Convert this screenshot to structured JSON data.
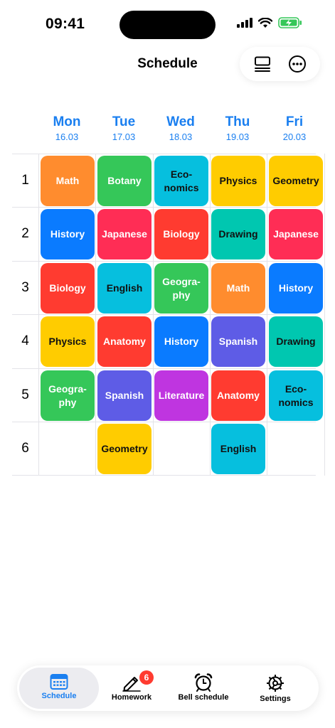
{
  "status_bar": {
    "time": "09:41"
  },
  "header": {
    "title": "Schedule",
    "layout_icon": "list-layout-icon",
    "more_icon": "ellipsis-circle-icon"
  },
  "days": [
    {
      "name": "Mon",
      "date": "16.03"
    },
    {
      "name": "Tue",
      "date": "17.03"
    },
    {
      "name": "Wed",
      "date": "18.03"
    },
    {
      "name": "Thu",
      "date": "19.03"
    },
    {
      "name": "Fri",
      "date": "20.03"
    }
  ],
  "periods": [
    "1",
    "2",
    "3",
    "4",
    "5",
    "6"
  ],
  "colors": {
    "orange": "#FF8C2E",
    "green": "#35C759",
    "cyan": "#06BFDE",
    "yellow": "#FFCC00",
    "blue": "#0A7BFF",
    "pink": "#FF2D55",
    "red": "#FF3B30",
    "teal": "#00C7B0",
    "indigo": "#5E5CE6",
    "purple": "#BF35E0",
    "accent": "#1A7FF0"
  },
  "lessons": [
    [
      {
        "name": "Math",
        "color": "orange",
        "text": "light"
      },
      {
        "name": "Botany",
        "color": "green",
        "text": "light"
      },
      {
        "name": "Eco-\nnomics",
        "color": "cyan",
        "text": "dark"
      },
      {
        "name": "Physics",
        "color": "yellow",
        "text": "dark"
      },
      {
        "name": "Geometry",
        "color": "yellow",
        "text": "dark"
      }
    ],
    [
      {
        "name": "History",
        "color": "blue",
        "text": "light"
      },
      {
        "name": "Japanese",
        "color": "pink",
        "text": "light"
      },
      {
        "name": "Biology",
        "color": "red",
        "text": "light"
      },
      {
        "name": "Drawing",
        "color": "teal",
        "text": "dark"
      },
      {
        "name": "Japanese",
        "color": "pink",
        "text": "light"
      }
    ],
    [
      {
        "name": "Biology",
        "color": "red",
        "text": "light"
      },
      {
        "name": "English",
        "color": "cyan",
        "text": "dark"
      },
      {
        "name": "Geogra-\nphy",
        "color": "green",
        "text": "light"
      },
      {
        "name": "Math",
        "color": "orange",
        "text": "light"
      },
      {
        "name": "History",
        "color": "blue",
        "text": "light"
      }
    ],
    [
      {
        "name": "Physics",
        "color": "yellow",
        "text": "dark"
      },
      {
        "name": "Anatomy",
        "color": "red",
        "text": "light"
      },
      {
        "name": "History",
        "color": "blue",
        "text": "light"
      },
      {
        "name": "Spanish",
        "color": "indigo",
        "text": "light"
      },
      {
        "name": "Drawing",
        "color": "teal",
        "text": "dark"
      }
    ],
    [
      {
        "name": "Geogra-\nphy",
        "color": "green",
        "text": "light"
      },
      {
        "name": "Spanish",
        "color": "indigo",
        "text": "light"
      },
      {
        "name": "Literature",
        "color": "purple",
        "text": "light"
      },
      {
        "name": "Anatomy",
        "color": "red",
        "text": "light"
      },
      {
        "name": "Eco-\nnomics",
        "color": "cyan",
        "text": "dark"
      }
    ],
    [
      null,
      {
        "name": "Geometry",
        "color": "yellow",
        "text": "dark"
      },
      null,
      {
        "name": "English",
        "color": "cyan",
        "text": "dark"
      },
      null
    ]
  ],
  "tabbar": {
    "tabs": [
      {
        "label": "Schedule",
        "icon": "calendar-icon",
        "active": true
      },
      {
        "label": "Homework",
        "icon": "pencil-icon",
        "badge": "6"
      },
      {
        "label": "Bell schedule",
        "icon": "alarm-clock-icon"
      },
      {
        "label": "Settings",
        "icon": "gear-icon"
      }
    ]
  }
}
